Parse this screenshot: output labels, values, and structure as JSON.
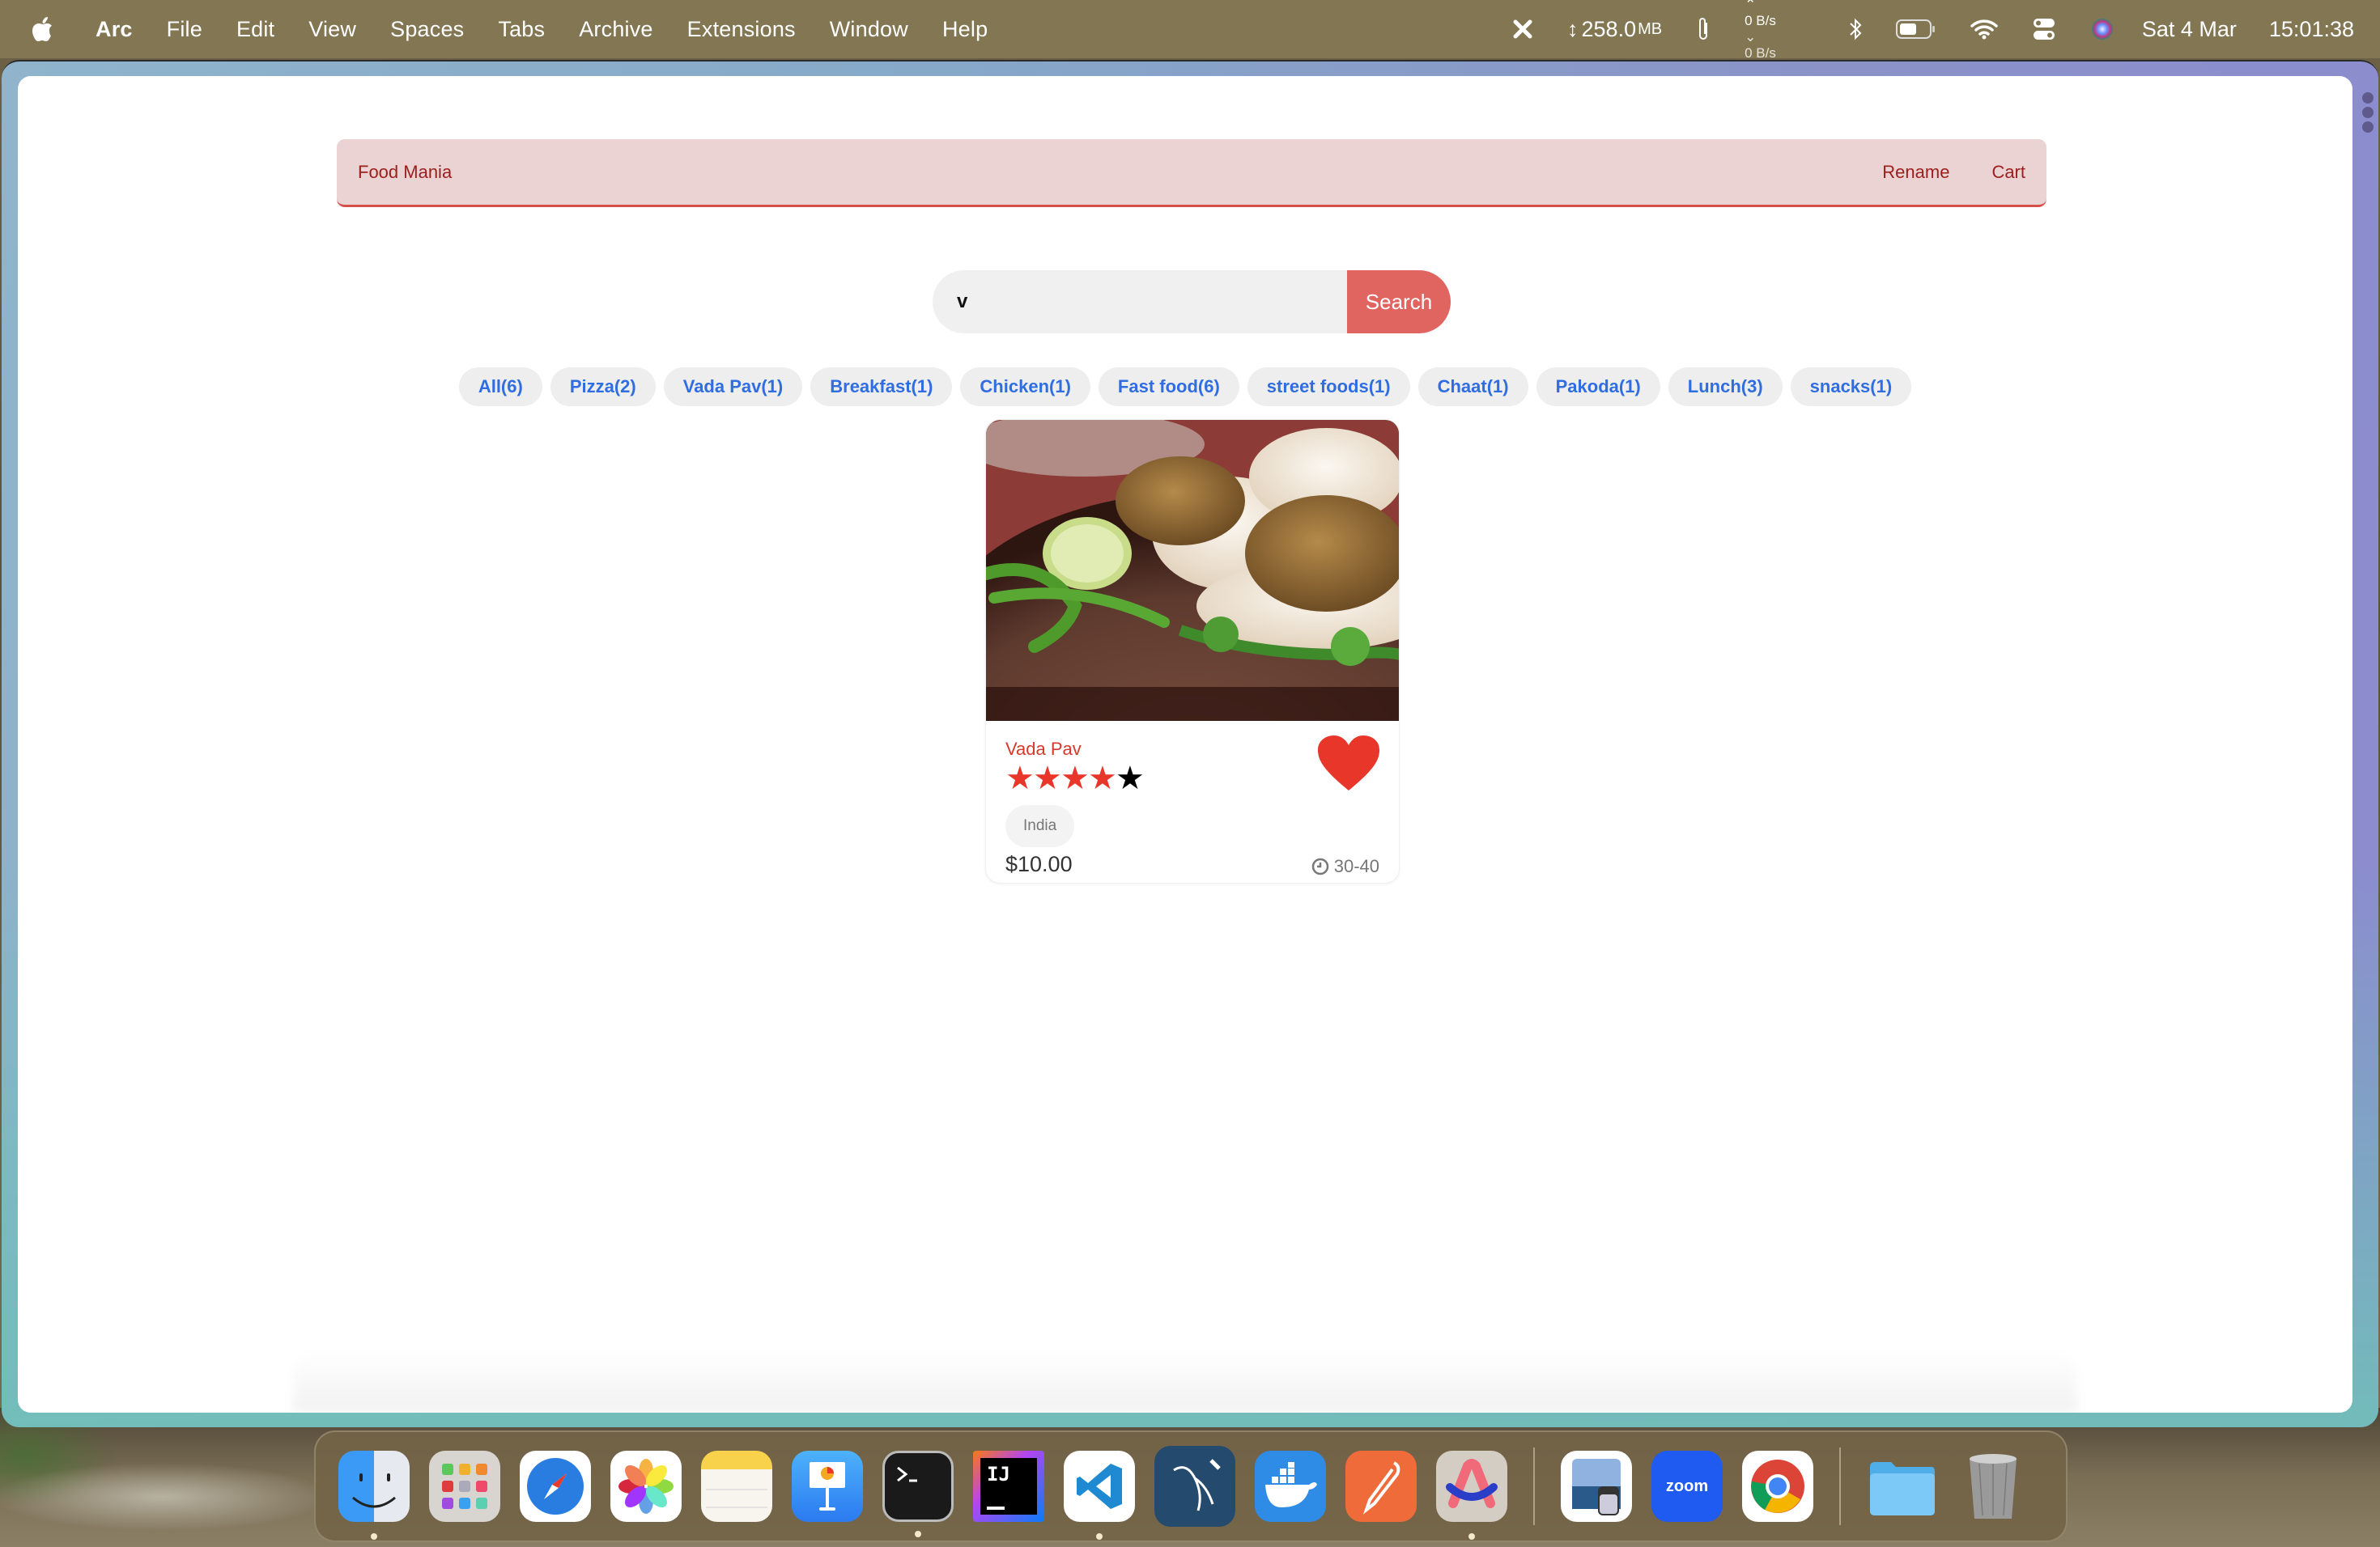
{
  "menubar": {
    "app_name": "Arc",
    "items": [
      "File",
      "Edit",
      "View",
      "Spaces",
      "Tabs",
      "Archive",
      "Extensions",
      "Window",
      "Help"
    ],
    "memory": "258.0",
    "memory_unit": "MB",
    "net_up": "0 B/s",
    "net_down": "0 B/s",
    "date": "Sat 4 Mar",
    "time": "15:01:38"
  },
  "navbar": {
    "brand": "Food Mania",
    "links": [
      "Rename",
      "Cart"
    ]
  },
  "search": {
    "value": "v",
    "placeholder": "",
    "button_label": "Search"
  },
  "tags": [
    "All(6)",
    "Pizza(2)",
    "Vada Pav(1)",
    "Breakfast(1)",
    "Chicken(1)",
    "Fast food(6)",
    "street foods(1)",
    "Chaat(1)",
    "Pakoda(1)",
    "Lunch(3)",
    "snacks(1)"
  ],
  "foods": [
    {
      "name": "Vada Pav",
      "rating": 4,
      "max_rating": 5,
      "origin": "India",
      "price": "$10.00",
      "cook_time": "30-40",
      "favorite": true,
      "image": "vada-pav-photo"
    }
  ],
  "colors": {
    "accent": "#e0645f",
    "brand_text": "#9b1e1b",
    "navbar_bg": "#ebd3d4",
    "tag_text": "#2f6de0",
    "star_filled": "#e8372a",
    "heart": "#e8372a"
  },
  "dock": {
    "apps": [
      {
        "name": "Finder",
        "running": true
      },
      {
        "name": "Launchpad",
        "running": false
      },
      {
        "name": "Safari",
        "running": false
      },
      {
        "name": "Photos",
        "running": false
      },
      {
        "name": "Notes",
        "running": false
      },
      {
        "name": "Keynote",
        "running": false
      },
      {
        "name": "Terminal",
        "running": true
      },
      {
        "name": "IntelliJ IDEA",
        "running": false
      },
      {
        "name": "Visual Studio Code",
        "running": true
      },
      {
        "name": "MySQL Workbench",
        "running": false
      },
      {
        "name": "Docker",
        "running": false
      },
      {
        "name": "Postman",
        "running": false
      },
      {
        "name": "Arc",
        "running": true
      },
      {
        "name": "Preview",
        "running": false
      },
      {
        "name": "Zoom",
        "running": false
      },
      {
        "name": "Google Chrome",
        "running": false
      },
      {
        "name": "Downloads",
        "running": false
      },
      {
        "name": "Trash",
        "running": false
      }
    ],
    "zoom_label": "zoom",
    "intellij_label": "IJ"
  }
}
